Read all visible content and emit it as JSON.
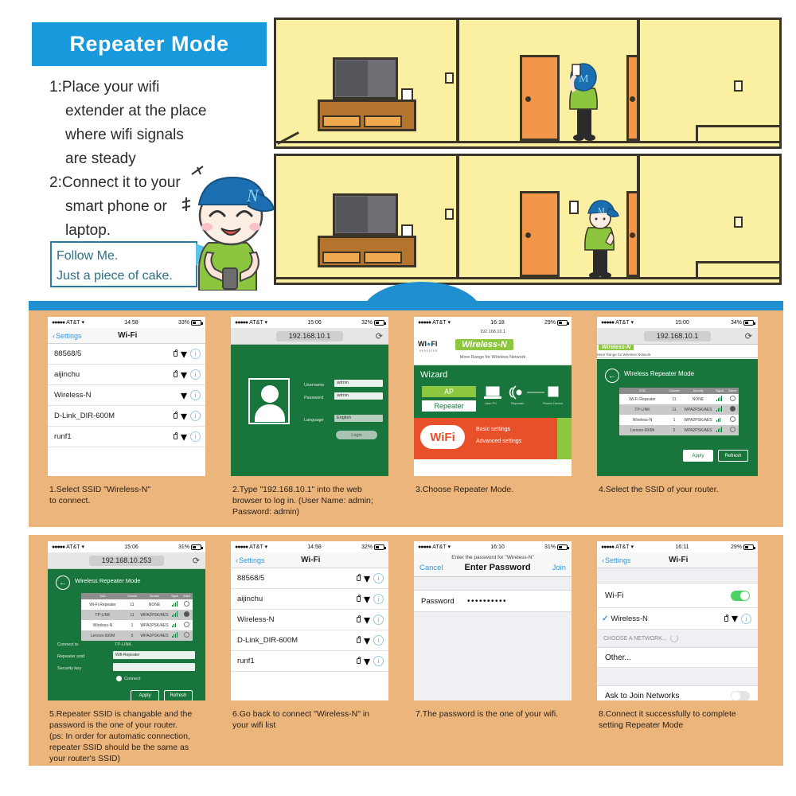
{
  "header": {
    "title": "Repeater Mode",
    "title_bg": "#1799dc",
    "steps": [
      "1:Place your wifi",
      "extender at the place",
      "where wifi signals",
      "are steady",
      "2:Connect it to your",
      "smart phone or",
      "laptop."
    ],
    "bubble": {
      "line1": "Follow Me.",
      "line2": "Just a piece of cake."
    }
  },
  "illustration": {
    "scene1_name": "room-scene-person-at-doorway",
    "scene2_name": "room-scene-person-with-extender",
    "wall_color": "#fbf0a2",
    "door_color": "#f2974a",
    "cap_color": "#1f6fd0",
    "shirt_color": "#8cc63f"
  },
  "panels": [
    {
      "id": 1,
      "kind": "ios-wifi-list",
      "status": {
        "carrier": "AT&T",
        "time": "14:58",
        "battery": "33%"
      },
      "nav": {
        "back": "Settings",
        "title": "Wi-Fi"
      },
      "networks": [
        {
          "ssid": "88568/5",
          "locked": true
        },
        {
          "ssid": "aijinchu",
          "locked": true
        },
        {
          "ssid": "Wireless-N",
          "locked": false
        },
        {
          "ssid": "D-Link_DIR-600M",
          "locked": true
        },
        {
          "ssid": "runf1",
          "locked": true
        }
      ],
      "caption": "1.Select SSID \"Wireless-N\"\nto connect."
    },
    {
      "id": 2,
      "kind": "router-login",
      "status": {
        "carrier": "AT&T",
        "time": "15:06",
        "battery": "32%"
      },
      "url": "192.168.10.1",
      "form": {
        "username_label": "Username",
        "username_value": "admin",
        "password_label": "Password",
        "password_value": "admin",
        "language_label": "Language",
        "language_value": "English",
        "submit_label": "Login"
      },
      "caption": "2.Type \"192.168.10.1\" into the web\nbrowser to log in. (User Name: admin;\nPassword: admin)"
    },
    {
      "id": 3,
      "kind": "router-wizard",
      "status": {
        "carrier": "AT&T",
        "time": "16:18",
        "battery": "29%"
      },
      "url": "192.168.10.1",
      "brand": "Wireless-N",
      "brand_logo": "WI-FI REPEATER",
      "tagline": "More Range for Wireless Network",
      "wizard_title": "Wizard",
      "modes": [
        "AP",
        "Repeater"
      ],
      "diagram_labels": [
        "User PC",
        "Repeater",
        "Router Device"
      ],
      "banner_logo": "WiFi",
      "banner_links": [
        "Basic settings",
        "Advanced settings"
      ],
      "caption": "3.Choose Repeater Mode."
    },
    {
      "id": 4,
      "kind": "router-ssid-scan",
      "status": {
        "carrier": "AT&T",
        "time": "15:00",
        "battery": "34%"
      },
      "url": "192.168.10.1",
      "brand": "Wireless-N",
      "tagline": "More Range for Wireless Network",
      "page_title": "Wireless Repeater Mode",
      "table_headers": [
        "SSID",
        "Channel",
        "Security",
        "Signal",
        "Select"
      ],
      "table_rows": [
        {
          "ssid": "Wi-Fi Repeater",
          "channel": "11",
          "security": "NONE",
          "signal": 4
        },
        {
          "ssid": "TP-LINK",
          "channel": "11",
          "security": "WPA2PSK/AES",
          "signal": 4
        },
        {
          "ssid": "Wireless-N",
          "channel": "1",
          "security": "WPA2PSK/AES",
          "signal": 3
        },
        {
          "ssid": "Lenovo-600M",
          "channel": "5",
          "security": "WPA2PSK/AES",
          "signal": 4
        }
      ],
      "buttons": [
        "Apply",
        "Refresh"
      ],
      "caption": "4.Select the SSID of your router."
    },
    {
      "id": 5,
      "kind": "router-repeater-config",
      "status": {
        "carrier": "AT&T",
        "time": "15:06",
        "battery": "31%"
      },
      "url": "192.168.10.253",
      "page_title": "Wireless Repeater Mode",
      "table_headers": [
        "SSID",
        "Channel",
        "Security",
        "Signal",
        "Select"
      ],
      "table_rows": [
        {
          "ssid": "Wi-Fi Repeater",
          "channel": "11",
          "security": "NONE",
          "signal": 4
        },
        {
          "ssid": "TP-LINK",
          "channel": "11",
          "security": "WPA2PSK/AES",
          "signal": 4
        },
        {
          "ssid": "Wireless-N",
          "channel": "1",
          "security": "WPA2PSK/AES",
          "signal": 3
        },
        {
          "ssid": "Lenovo-600M",
          "channel": "5",
          "security": "WPA2PSK/AES",
          "signal": 4
        }
      ],
      "fields": [
        {
          "label": "Connect to",
          "value": "TP-LINK"
        },
        {
          "label": "Repeater ssid",
          "value": "Wifi-Repeater"
        },
        {
          "label": "Security key",
          "value": ""
        }
      ],
      "checkbox_label": "Connect",
      "buttons": [
        "Apply",
        "Refresh"
      ],
      "caption": "5.Repeater SSID is changable and the\npassword is the one of your router.\n(ps: In order for automatic connection,\nrepeater SSID should be the same as\nyour router's SSID)"
    },
    {
      "id": 6,
      "kind": "ios-wifi-list",
      "status": {
        "carrier": "AT&T",
        "time": "14:58",
        "battery": "32%"
      },
      "nav": {
        "back": "Settings",
        "title": "Wi-Fi"
      },
      "networks": [
        {
          "ssid": "88568/5",
          "locked": true
        },
        {
          "ssid": "aijinchu",
          "locked": true
        },
        {
          "ssid": "Wireless-N",
          "locked": true
        },
        {
          "ssid": "D-Link_DIR-600M",
          "locked": true
        },
        {
          "ssid": "runf1",
          "locked": true
        }
      ],
      "caption": "6.Go back to connect \"Wireless-N\" in\nyour wifi list"
    },
    {
      "id": 7,
      "kind": "ios-password",
      "status": {
        "carrier": "AT&T",
        "time": "16:10",
        "battery": "31%"
      },
      "prompt": "Enter the password for \"Wireless-N\"",
      "cancel_label": "Cancel",
      "title": "Enter Password",
      "join_label": "Join",
      "field_label": "Password",
      "field_value": "••••••••••",
      "caption": "7.The password is the one of your wifi."
    },
    {
      "id": 8,
      "kind": "ios-wifi-connected",
      "status": {
        "carrier": "AT&T",
        "time": "16:11",
        "battery": "29%"
      },
      "nav": {
        "back": "Settings",
        "title": "Wi-Fi"
      },
      "wifi_toggle_label": "Wi-Fi",
      "wifi_toggle_on": true,
      "connected_ssid": "Wireless-N",
      "section_header": "CHOOSE A NETWORK...",
      "other_label": "Other...",
      "ask_label": "Ask to Join Networks",
      "caption": "8.Connect it successfully to complete\nsetting Repeater Mode"
    }
  ]
}
